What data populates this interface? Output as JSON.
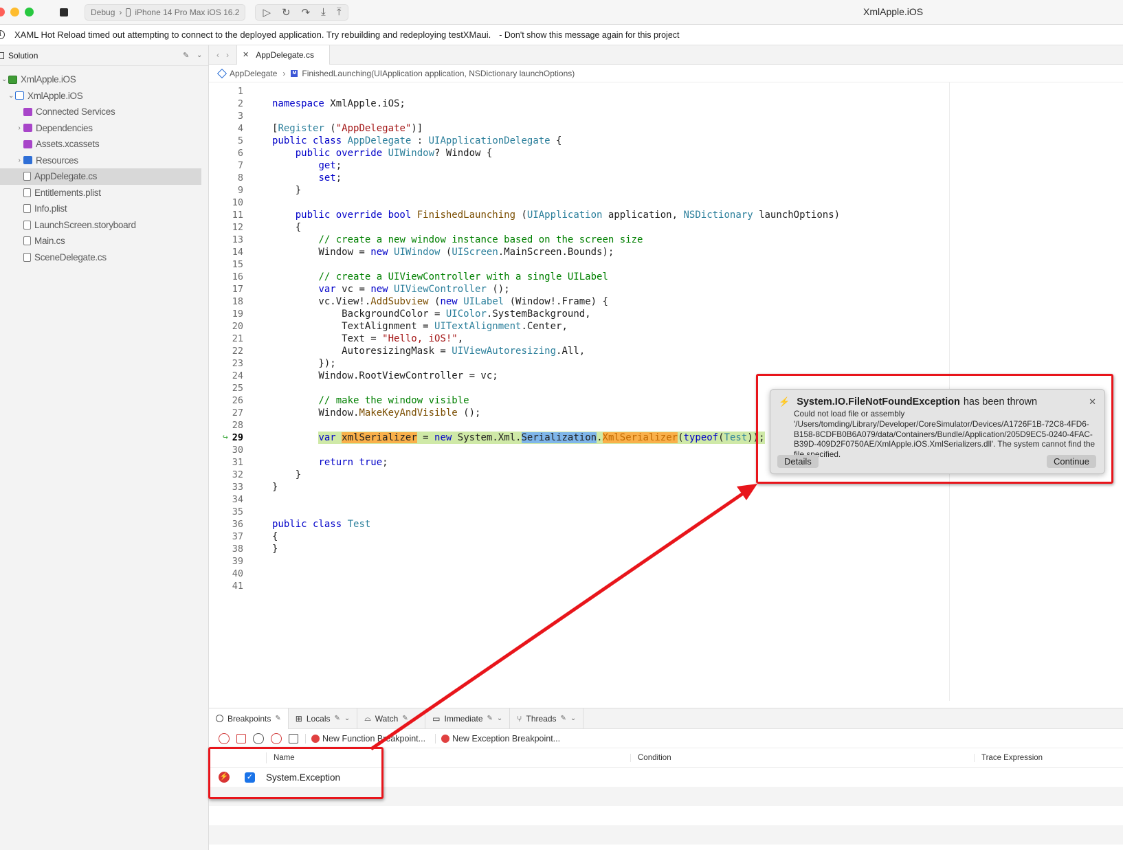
{
  "window": {
    "title": "XmlApple.iOS"
  },
  "toolbar": {
    "config": "Debug",
    "device": "iPhone 14 Pro Max iOS 16.2"
  },
  "infobar": {
    "message": "XAML Hot Reload timed out attempting to connect to the deployed application. Try rebuilding and redeploying testXMaui.",
    "link": "- Don't show this message again for this project"
  },
  "sidebar": {
    "title": "Solution",
    "items": [
      {
        "label": "XmlApple.iOS",
        "icon": "solution-icon"
      },
      {
        "label": "XmlApple.iOS",
        "icon": "project-icon"
      },
      {
        "label": "Connected Services",
        "icon": "connected-services-icon"
      },
      {
        "label": "Dependencies",
        "icon": "dependencies-icon"
      },
      {
        "label": "Assets.xcassets",
        "icon": "assets-icon"
      },
      {
        "label": "Resources",
        "icon": "folder-icon"
      },
      {
        "label": "AppDelegate.cs",
        "icon": "file-icon"
      },
      {
        "label": "Entitlements.plist",
        "icon": "file-icon"
      },
      {
        "label": "Info.plist",
        "icon": "file-icon"
      },
      {
        "label": "LaunchScreen.storyboard",
        "icon": "file-icon"
      },
      {
        "label": "Main.cs",
        "icon": "file-icon"
      },
      {
        "label": "SceneDelegate.cs",
        "icon": "file-icon"
      }
    ]
  },
  "editor": {
    "tab": "AppDelegate.cs",
    "breadcrumb": {
      "class": "AppDelegate",
      "method": "FinishedLaunching(UIApplication application, NSDictionary launchOptions)"
    },
    "line_numbers": [
      "1",
      "2",
      "3",
      "4",
      "5",
      "6",
      "7",
      "8",
      "9",
      "10",
      "11",
      "12",
      "13",
      "14",
      "15",
      "16",
      "17",
      "18",
      "19",
      "20",
      "21",
      "22",
      "23",
      "24",
      "25",
      "26",
      "27",
      "28",
      "29",
      "30",
      "31",
      "32",
      "33",
      "34",
      "35",
      "36",
      "37",
      "38",
      "39",
      "40",
      "41"
    ],
    "current_line": "29"
  },
  "exception": {
    "name": "System.IO.FileNotFoundException",
    "suffix": "has been thrown",
    "description": "Could not load file or assembly '/Users/tomding/Library/Developer/CoreSimulator/Devices/A1726F1B-72C8-4FD6-B158-8CDFB0B6A079/data/Containers/Bundle/Application/205D9EC5-0240-4FAC-B39D-409D2F0750AE/XmlApple.iOS.XmlSerializers.dll'. The system cannot find the file specified.",
    "details_label": "Details",
    "continue_label": "Continue"
  },
  "pads": {
    "tabs": [
      {
        "label": "Breakpoints"
      },
      {
        "label": "Locals"
      },
      {
        "label": "Watch"
      },
      {
        "label": "Immediate"
      },
      {
        "label": "Threads"
      }
    ],
    "new_function_bp": "New Function Breakpoint...",
    "new_exception_bp": "New Exception Breakpoint...",
    "columns": {
      "name": "Name",
      "condition": "Condition",
      "trace": "Trace Expression"
    },
    "rows": [
      {
        "name": "System.Exception",
        "enabled": true
      }
    ]
  },
  "colors": {
    "highlight_red": "#e8151b",
    "exec_line": "#cfe9a7",
    "accent": "#1a73e8"
  }
}
